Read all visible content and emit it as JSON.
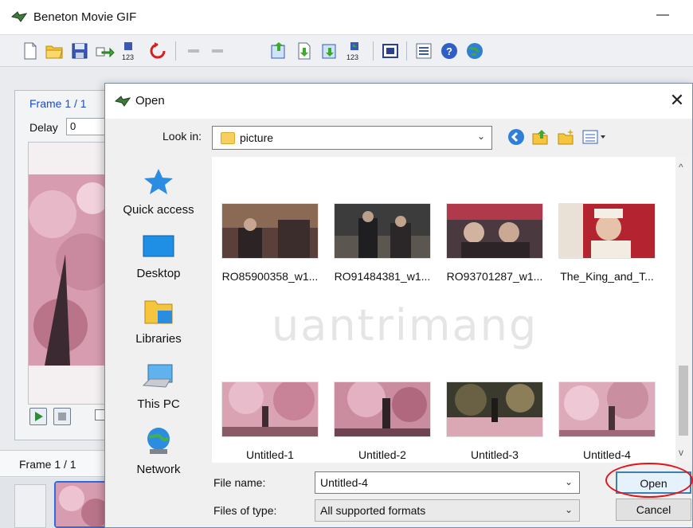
{
  "app": {
    "title": "Beneton Movie GIF",
    "minimize_glyph": "—",
    "toolbar_icons": [
      "new-file-icon",
      "open-folder-icon",
      "save-icon",
      "export-arrow-icon",
      "numbering-icon",
      "rotate-icon",
      "undo-icon",
      "redo-icon",
      "insert-image-icon",
      "import-frames-icon",
      "import-file-icon",
      "numbered-import-icon",
      "resize-icon",
      "properties-list-icon",
      "help-icon",
      "web-globe-icon"
    ]
  },
  "frame_panel": {
    "frame_label": "Frame 1 / 1",
    "delay_label": "Delay",
    "delay_value": "0"
  },
  "bottom": {
    "frame_label": "Frame 1 / 1"
  },
  "dialog": {
    "title": "Open",
    "close_glyph": "✕",
    "look_in_label": "Look in:",
    "look_in_value": "picture",
    "caret": "⌄",
    "places": [
      {
        "label": "Quick access",
        "icon": "quick-access-star-icon"
      },
      {
        "label": "Desktop",
        "icon": "desktop-icon"
      },
      {
        "label": "Libraries",
        "icon": "libraries-icon"
      },
      {
        "label": "This PC",
        "icon": "this-pc-icon"
      },
      {
        "label": "Network",
        "icon": "network-icon"
      }
    ],
    "files": [
      {
        "label": "RO85900358_w1..."
      },
      {
        "label": "RO91484381_w1..."
      },
      {
        "label": "RO93701287_w1..."
      },
      {
        "label": "The_King_and_T..."
      },
      {
        "label": "Untitled-1"
      },
      {
        "label": "Untitled-2"
      },
      {
        "label": "Untitled-3"
      },
      {
        "label": "Untitled-4"
      }
    ],
    "watermark": "uantrimang",
    "file_name_label": "File name:",
    "file_name_value": "Untitled-4",
    "file_type_label": "Files of type:",
    "file_type_value": "All supported formats",
    "open_label": "Open",
    "cancel_label": "Cancel",
    "scroll_up": "^",
    "scroll_down": "v"
  },
  "colors": {
    "accent_blue": "#1a4bd0",
    "highlight_red": "#e0151b",
    "open_button_border": "#3c7fb1"
  }
}
